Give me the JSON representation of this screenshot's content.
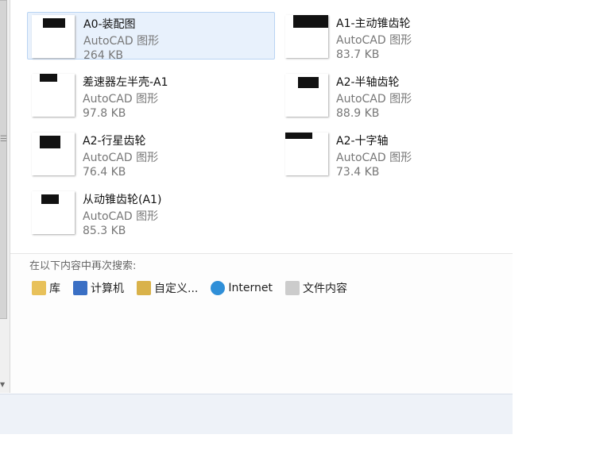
{
  "files": [
    {
      "name": "A0-装配图",
      "type": "AutoCAD 图形",
      "size": "264 KB",
      "selected": true
    },
    {
      "name": "A1-主动锥齿轮",
      "type": "AutoCAD 图形",
      "size": "83.7 KB"
    },
    {
      "name": "差速器左半壳-A1",
      "type": "AutoCAD 图形",
      "size": "97.8 KB"
    },
    {
      "name": "A2-半轴齿轮",
      "type": "AutoCAD 图形",
      "size": "88.9 KB"
    },
    {
      "name": "A2-行星齿轮",
      "type": "AutoCAD 图形",
      "size": "76.4 KB"
    },
    {
      "name": "A2-十字轴",
      "type": "AutoCAD 图形",
      "size": "73.4 KB"
    },
    {
      "name": "从动锥齿轮(A1)",
      "type": "AutoCAD 图形",
      "size": "85.3 KB"
    }
  ],
  "search_again": {
    "label": "在以下内容中再次搜索:",
    "links": [
      {
        "label": "库",
        "icon": "library-icon",
        "color": "#e8c15a"
      },
      {
        "label": "计算机",
        "icon": "computer-icon",
        "color": "#3a6fc4"
      },
      {
        "label": "自定义...",
        "icon": "custom-folder-icon",
        "color": "#d9b24a"
      },
      {
        "label": "Internet",
        "icon": "internet-icon",
        "color": "#2f8fd8"
      },
      {
        "label": "文件内容",
        "icon": "file-contents-icon",
        "color": "#cccccc"
      }
    ]
  }
}
